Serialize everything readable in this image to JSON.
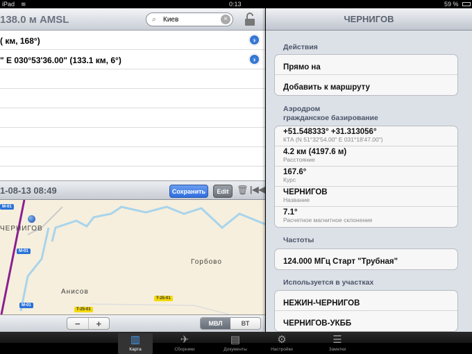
{
  "status": {
    "device": "iPad",
    "time": "0:13",
    "battery": "59 %"
  },
  "left": {
    "header_title": "138.0 м AMSL",
    "search": {
      "value": "Киев"
    },
    "rows": [
      "( км, 168°)",
      "\" E 030°53'36.00\" (133.1 км, 6°)",
      "",
      "",
      "",
      "",
      "",
      ""
    ],
    "toolbar": {
      "date": "1-08-13 08:49",
      "save": "Сохранить",
      "edit": "Edit"
    },
    "map": {
      "city": "ЧЕРНИГОВ",
      "town1": "Горбово",
      "town2": "Анисов",
      "roads": [
        "M-01",
        "M-01",
        "M-01",
        "T-25-01",
        "T-25-01"
      ]
    },
    "zoom": {
      "minus": "−",
      "plus": "+"
    },
    "mode": {
      "a": "МВЛ",
      "b": "ВТ",
      "selected": "МВЛ"
    }
  },
  "right": {
    "title": "ЧЕРНИГОВ",
    "actions_label": "Действия",
    "actions": [
      "Прямо на",
      "Добавить к маршруту"
    ],
    "aero_label1": "Аэродром",
    "aero_label2": "гражданское базирование",
    "details": [
      {
        "main": "+51.548333° +31.313056°",
        "sub": "КТА (N 51°32'54.00\" E 031°18'47.00\")"
      },
      {
        "main": "4.2 км (4197.6 м)",
        "sub": "Расстояние"
      },
      {
        "main": "167.6°",
        "sub": "Курс"
      },
      {
        "main": "ЧЕРНИГОВ",
        "sub": "Название"
      },
      {
        "main": "7.1°",
        "sub": "Расчетное магнитное склонение"
      }
    ],
    "freq_label": "Частоты",
    "freqs": [
      "124.000 МГц Старт \"Трубная\""
    ],
    "used_label": "Используется в участках",
    "used": [
      "НЕЖИН-ЧЕРНИГОВ",
      "ЧЕРНИГОВ-УКББ"
    ]
  },
  "tabs": [
    {
      "label": "Карта",
      "icon": "map-icon"
    },
    {
      "label": "Сборники",
      "icon": "airplane-icon"
    },
    {
      "label": "Документы",
      "icon": "tray-icon"
    },
    {
      "label": "Настройки",
      "icon": "gear-icon"
    },
    {
      "label": "Заметки",
      "icon": "notepad-icon"
    }
  ],
  "colors": {
    "accent": "#2f6fe0",
    "route": "#8a1f8f",
    "water": "#a8d4ec"
  }
}
